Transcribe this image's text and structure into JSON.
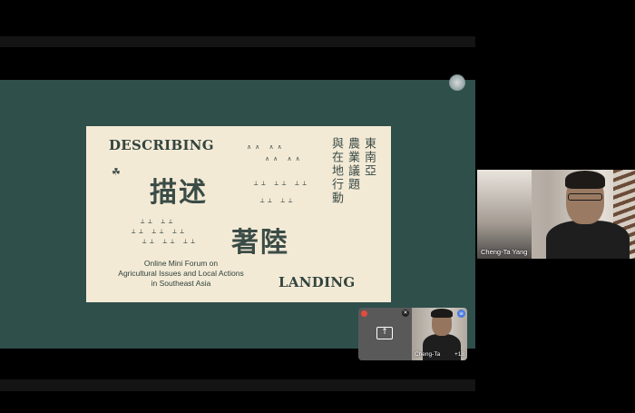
{
  "slide": {
    "title_en_1": "DESCRIBING",
    "title_en_2": "LANDING",
    "title_cn_1": "描述",
    "title_cn_2": "著陸",
    "vertical_lines": [
      "東南亞",
      "農業議題",
      "與在地行動"
    ],
    "subtitle_lines": [
      "Online Mini Forum on",
      "Agricultural Issues and Local Actions",
      "in Southeast Asia"
    ]
  },
  "participants": {
    "main_tile_name": "Cheng-Ta Yang",
    "self_tile_name": "Cheng-Ta",
    "others_count": "+18"
  },
  "icons": {
    "present": "present-screen-icon",
    "mic_off": "mic-off-icon",
    "audio": "audio-level-icon",
    "close": "close-dot-icon"
  },
  "colors": {
    "share_background": "#2f4f4b",
    "slide_background": "#f3ead6",
    "slide_text": "#33443f"
  }
}
